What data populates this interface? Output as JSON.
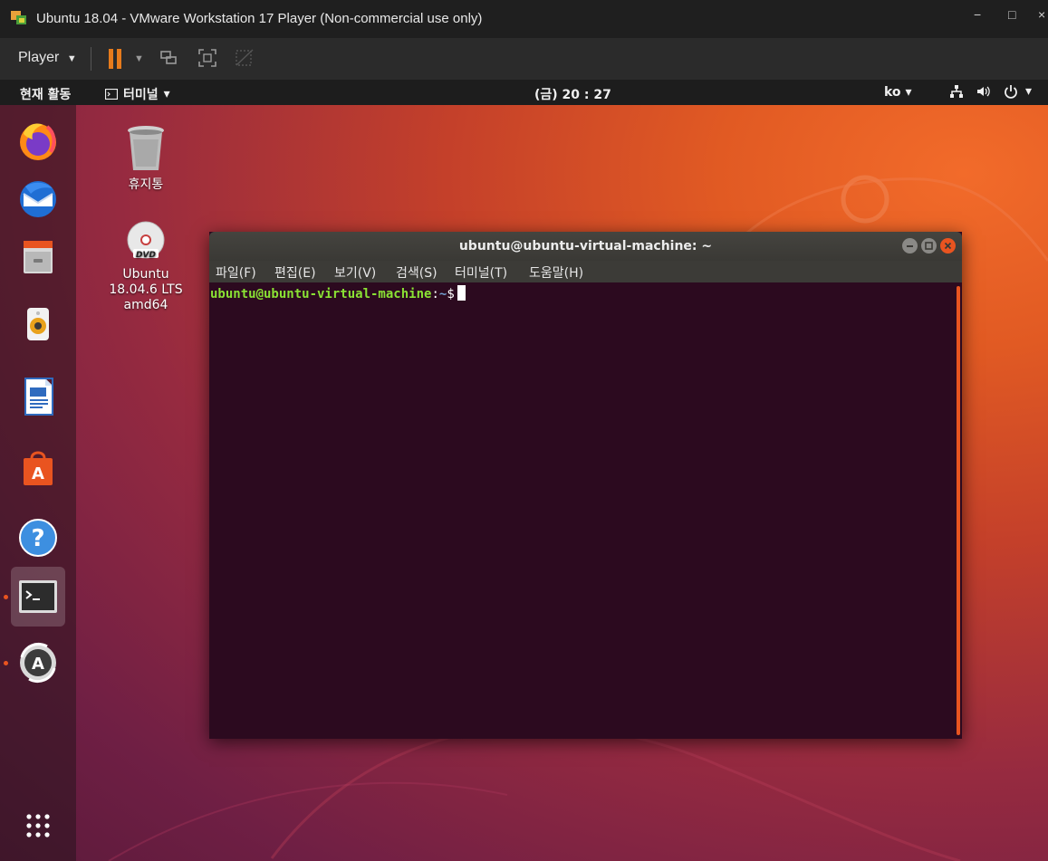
{
  "vm": {
    "title": "Ubuntu 18.04 - VMware Workstation 17 Player (Non-commercial use only)",
    "player_menu": "Player",
    "win_controls": {
      "minimize": "−",
      "maximize": "□",
      "close": "×"
    }
  },
  "ubuntu": {
    "topbar": {
      "activities": "현재 활동",
      "app_menu": "터미널",
      "clock": "(금) 20 : 27",
      "language": "ko",
      "arrow": "▾"
    },
    "dock": {
      "items": [
        {
          "name": "firefox",
          "active": false,
          "running": false
        },
        {
          "name": "thunderbird",
          "active": false,
          "running": false
        },
        {
          "name": "files",
          "active": false,
          "running": false
        },
        {
          "name": "rhythmbox",
          "active": false,
          "running": false
        },
        {
          "name": "libreoffice-writer",
          "active": false,
          "running": false
        },
        {
          "name": "ubuntu-software",
          "active": false,
          "running": false
        },
        {
          "name": "help",
          "active": false,
          "running": false
        },
        {
          "name": "terminal",
          "active": true,
          "running": true
        },
        {
          "name": "software-updater",
          "active": false,
          "running": true
        }
      ],
      "apps_grid": "show-applications"
    },
    "desktop_icons": {
      "trash": {
        "label": "휴지통"
      },
      "dvd": {
        "label_line1": "Ubuntu",
        "label_line2": "18.04.6 LTS",
        "label_line3": "amd64",
        "badge": "DVD"
      }
    },
    "terminal": {
      "title": "ubuntu@ubuntu-virtual-machine: ~",
      "menu": [
        "파일(F)",
        "편집(E)",
        "보기(V)",
        "검색(S)",
        "터미널(T)",
        "도움말(H)"
      ],
      "prompt_user": "ubuntu@ubuntu-virtual-machine",
      "prompt_colon": ":",
      "prompt_path": "~",
      "prompt_symbol": "$"
    }
  },
  "colors": {
    "accent": "#e95420",
    "pause_icon": "#e67b1c",
    "terminal_bg": "#2c0a1f",
    "prompt_user": "#8ae234",
    "prompt_path": "#729fcf"
  }
}
